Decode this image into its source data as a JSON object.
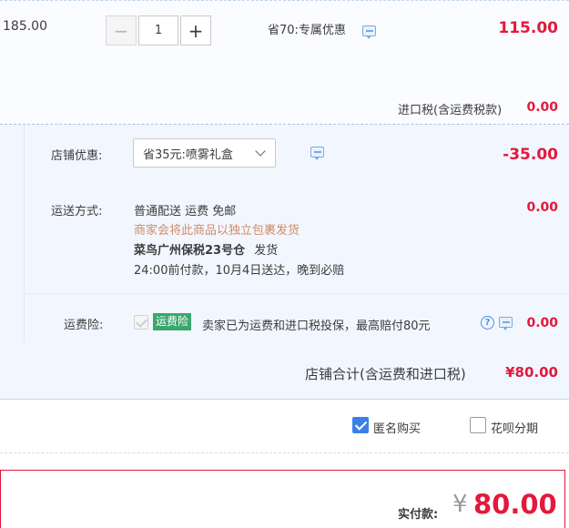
{
  "item": {
    "unit_price": "185.00",
    "quantity": "1",
    "decrement_symbol": "−",
    "increment_symbol": "+",
    "promo_text": "省70:专属优惠",
    "item_total": "115.00",
    "tax_label": "进口税(含运费税款)",
    "tax_value": "0.00"
  },
  "shop": {
    "discount_label": "店铺优惠:",
    "discount_selected": "省35元:喷雾礼盒",
    "discount_value": "-35.00",
    "shipping_label": "运送方式:",
    "shipping_method": "普通配送 运费 免邮",
    "shipping_note": "商家会将此商品以独立包裹发货",
    "warehouse": "菜鸟广州保税23号仓",
    "warehouse_suffix": "发货",
    "delivery_promise": "24:00前付款，10月4日送达，晚到必赔",
    "shipping_value": "0.00",
    "insurance_label": "运费险:",
    "insurance_badge": "运费险",
    "insurance_text": "卖家已为运费和进口税投保，最高赔付80元",
    "help_symbol": "?",
    "insurance_value": "0.00",
    "total_label": "店铺合计(含运费和进口税)",
    "total_value": "¥80.00"
  },
  "options": {
    "anonymous_label": "匿名购买",
    "anonymous_checked": true,
    "huabei_label": "花呗分期",
    "huabei_checked": false
  },
  "payment": {
    "label": "实付款:",
    "currency": "¥",
    "amount": "80.00"
  },
  "colors": {
    "accent_red": "#e3193b",
    "section_bg": "#f2f7ff",
    "insurance_green": "#3aa76d",
    "checkbox_blue": "#3b80e8"
  }
}
